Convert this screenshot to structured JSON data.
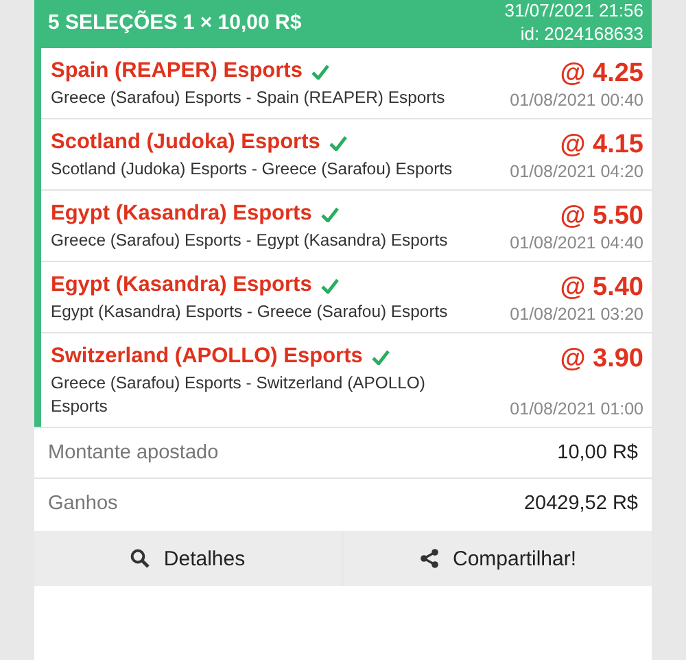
{
  "header": {
    "title": "5 SELEÇÕES 1 × 10,00 R$",
    "datetime": "31/07/2021 21:56",
    "id": "id: 2024168633"
  },
  "selections": [
    {
      "pick": "Spain (REAPER) Esports",
      "won": true,
      "odd": "@ 4.25",
      "match": "Greece (Sarafou) Esports - Spain (REAPER) Esports",
      "date": "01/08/2021 00:40"
    },
    {
      "pick": "Scotland (Judoka) Esports",
      "won": true,
      "odd": "@ 4.15",
      "match": "Scotland (Judoka) Esports - Greece (Sarafou) Esports",
      "date": "01/08/2021 04:20"
    },
    {
      "pick": "Egypt (Kasandra) Esports",
      "won": true,
      "odd": "@ 5.50",
      "match": "Greece (Sarafou) Esports - Egypt (Kasandra) Esports",
      "date": "01/08/2021 04:40"
    },
    {
      "pick": "Egypt (Kasandra) Esports",
      "won": true,
      "odd": "@ 5.40",
      "match": "Egypt (Kasandra) Esports - Greece (Sarafou) Esports",
      "date": "01/08/2021 03:20"
    },
    {
      "pick": "Switzerland (APOLLO) Esports",
      "won": true,
      "odd": "@ 3.90",
      "match": "Greece (Sarafou) Esports - Switzerland (APOLLO) Esports",
      "date": "01/08/2021 01:00"
    }
  ],
  "summary": [
    {
      "label": "Montante apostado",
      "value": "10,00 R$"
    },
    {
      "label": "Ganhos",
      "value": "20429,52 R$"
    }
  ],
  "buttons": [
    {
      "label": "Detalhes",
      "kind": "search"
    },
    {
      "label": "Compartilhar!",
      "kind": "share"
    }
  ]
}
